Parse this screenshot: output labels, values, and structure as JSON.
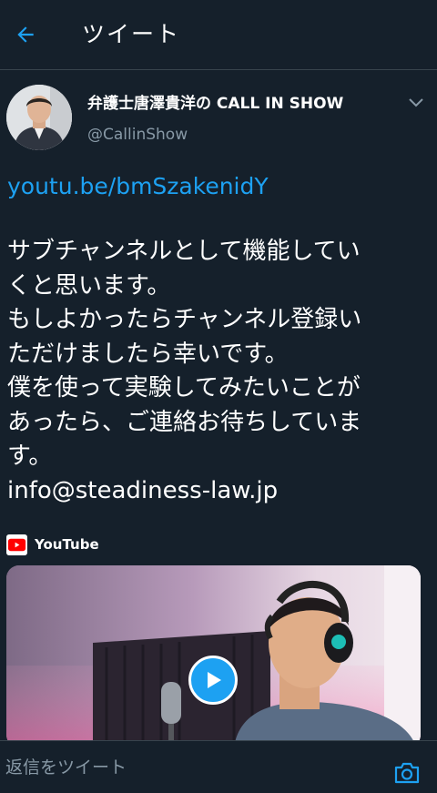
{
  "header": {
    "title": "ツイート",
    "back_icon": "arrow-left-icon"
  },
  "author": {
    "display_name": "弁護士唐澤貴洋の CALL IN SHOW",
    "handle": "@CallinShow",
    "menu_icon": "chevron-down-icon"
  },
  "tweet": {
    "link": "youtu.be/bmSzakenidY",
    "lines": [
      "サブチャンネルとして機能してい",
      "くと思います。",
      "もしよかったらチャンネル登録い",
      "ただけましたら幸いです。",
      "僕を使って実験してみたいことが",
      "あったら、ご連絡お待ちしていま",
      "す。",
      "info@steadiness-law.jp"
    ]
  },
  "card": {
    "source_label": "YouTube",
    "source_icon": "youtube-logo-icon",
    "play_icon": "play-icon"
  },
  "reply": {
    "placeholder": "返信をツイート",
    "camera_icon": "camera-icon"
  },
  "colors": {
    "background": "#15202b",
    "accent": "#1da1f2",
    "secondary_text": "#8899a6",
    "divider": "#38444d"
  }
}
